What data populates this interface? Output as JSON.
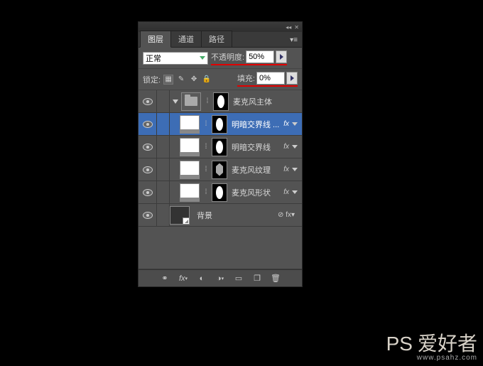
{
  "tabs": {
    "layers": "图层",
    "channels": "通道",
    "paths": "路径"
  },
  "blend": {
    "mode": "正常",
    "opacity_label": "不透明度:",
    "opacity_value": "50%"
  },
  "lock": {
    "label": "锁定:",
    "fill_label": "填充:",
    "fill_value": "0%"
  },
  "layers": [
    {
      "name": "麦克风主体",
      "kind": "group",
      "mask": "oval",
      "fx": false
    },
    {
      "name": "明暗交界线  ...",
      "kind": "layer",
      "mask": "oval",
      "fx": true,
      "selected": true
    },
    {
      "name": "明暗交界线",
      "kind": "layer",
      "mask": "oval",
      "fx": true
    },
    {
      "name": "麦克风纹理",
      "kind": "layer",
      "mask": "hex",
      "fx": true
    },
    {
      "name": "麦克风形状",
      "kind": "layer",
      "mask": "oval",
      "fx": true
    },
    {
      "name": "背景",
      "kind": "bg",
      "fx": false,
      "locked": true
    }
  ],
  "footer_icons": [
    "link",
    "fx",
    "mask",
    "adjust",
    "group",
    "new",
    "trash"
  ],
  "watermark": {
    "ps": "PS",
    "cn": "爱好者",
    "url": "www.psahz.com"
  },
  "colors": {
    "accent": "#3d6db5",
    "red": "#e00000"
  }
}
